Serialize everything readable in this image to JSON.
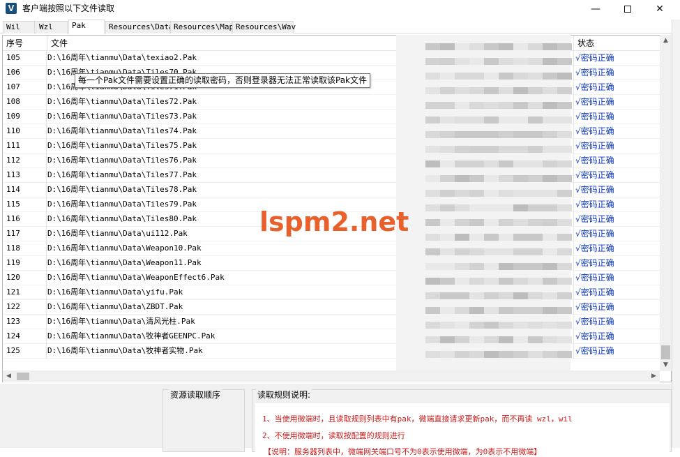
{
  "window": {
    "logo_letter": "V",
    "title": "客户端按照以下文件读取",
    "minimize": "—",
    "close": "✕"
  },
  "tabs": [
    {
      "label": "Wil",
      "active": false
    },
    {
      "label": "Wzl",
      "active": false
    },
    {
      "label": "Pak",
      "active": true
    },
    {
      "label": "Resources\\Data",
      "active": false
    },
    {
      "label": "Resources\\Map",
      "active": false
    },
    {
      "label": "Resources\\Wav",
      "active": false
    }
  ],
  "list": {
    "columns": {
      "id": "序号",
      "file": "文件",
      "status": "状态"
    },
    "rows": [
      {
        "id": "105",
        "file": "D:\\16周年\\tianmu\\Data\\texiao2.Pak",
        "status": "√密码正确"
      },
      {
        "id": "106",
        "file": "D:\\16周年\\tianmu\\Data\\Tiles70.Pak",
        "status": "√密码正确"
      },
      {
        "id": "107",
        "file": "D:\\16周年\\tianmu\\Data\\Tiles71.Pak",
        "status": "√密码正确"
      },
      {
        "id": "108",
        "file": "D:\\16周年\\tianmu\\Data\\Tiles72.Pak",
        "status": "√密码正确"
      },
      {
        "id": "109",
        "file": "D:\\16周年\\tianmu\\Data\\Tiles73.Pak",
        "status": "√密码正确"
      },
      {
        "id": "110",
        "file": "D:\\16周年\\tianmu\\Data\\Tiles74.Pak",
        "status": "√密码正确"
      },
      {
        "id": "111",
        "file": "D:\\16周年\\tianmu\\Data\\Tiles75.Pak",
        "status": "√密码正确"
      },
      {
        "id": "112",
        "file": "D:\\16周年\\tianmu\\Data\\Tiles76.Pak",
        "status": "√密码正确"
      },
      {
        "id": "113",
        "file": "D:\\16周年\\tianmu\\Data\\Tiles77.Pak",
        "status": "√密码正确"
      },
      {
        "id": "114",
        "file": "D:\\16周年\\tianmu\\Data\\Tiles78.Pak",
        "status": "√密码正确"
      },
      {
        "id": "115",
        "file": "D:\\16周年\\tianmu\\Data\\Tiles79.Pak",
        "status": "√密码正确"
      },
      {
        "id": "116",
        "file": "D:\\16周年\\tianmu\\Data\\Tiles80.Pak",
        "status": "√密码正确"
      },
      {
        "id": "117",
        "file": "D:\\16周年\\tianmu\\Data\\ui112.Pak",
        "status": "√密码正确"
      },
      {
        "id": "118",
        "file": "D:\\16周年\\tianmu\\Data\\Weapon10.Pak",
        "status": "√密码正确"
      },
      {
        "id": "119",
        "file": "D:\\16周年\\tianmu\\Data\\Weapon11.Pak",
        "status": "√密码正确"
      },
      {
        "id": "120",
        "file": "D:\\16周年\\tianmu\\Data\\WeaponEffect6.Pak",
        "status": "√密码正确"
      },
      {
        "id": "121",
        "file": "D:\\16周年\\tianmu\\Data\\yifu.Pak",
        "status": "√密码正确"
      },
      {
        "id": "122",
        "file": "D:\\16周年\\tianmu\\Data\\ZBDT.Pak",
        "status": "√密码正确"
      },
      {
        "id": "123",
        "file": "D:\\16周年\\tianmu\\Data\\清风光柱.Pak",
        "status": "√密码正确"
      },
      {
        "id": "124",
        "file": "D:\\16周年\\tianmu\\Data\\牧神者GEENPC.Pak",
        "status": "√密码正确"
      },
      {
        "id": "125",
        "file": "D:\\16周年\\tianmu\\Data\\牧神者实物.Pak",
        "status": "√密码正确"
      }
    ]
  },
  "tooltip": "每一个Pak文件需要设置正确的读取密码，否则登录器无法正常读取该Pak文件",
  "watermark": "lspm2.net",
  "bottom": {
    "order_group_label": "资源读取顺序",
    "rules_group_label": "读取规则说明:",
    "rules": [
      "1、当使用微端时，且读取规则列表中有pak，微端直接请求更新pak，而不再读 wzl，wil",
      "2、不使用微端时，读取按配置的规则进行",
      "【说明：服务器列表中，微端网关端口号不为0表示使用微端，为0表示不用微端】"
    ]
  },
  "scroll_arrows": {
    "up": "▲",
    "down": "▼",
    "left": "◀",
    "right": "▶"
  },
  "colors": {
    "status_blue": "#0b35c4",
    "rule_red": "#cc1c1c",
    "watermark_orange": "#e8612c",
    "logo_blue": "#1a4f7a"
  }
}
